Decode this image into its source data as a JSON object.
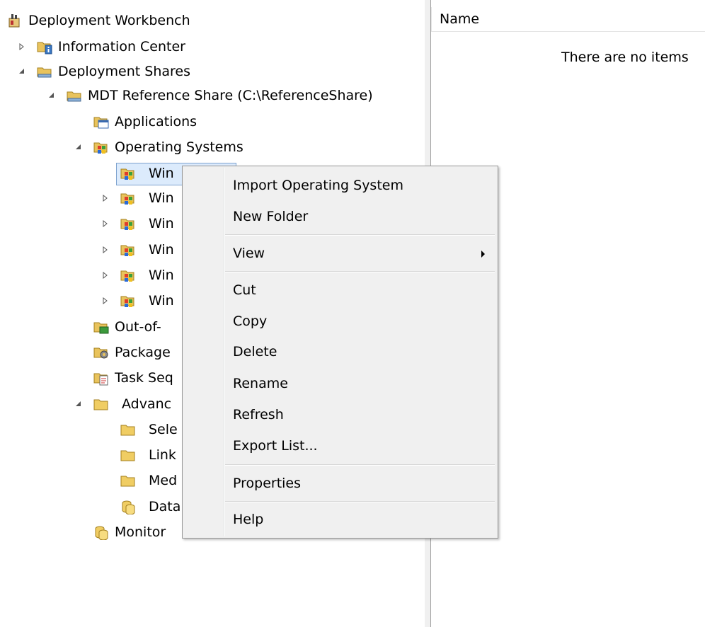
{
  "tree": {
    "root": "Deployment Workbench",
    "information_center": "Information Center",
    "deployment_shares": "Deployment Shares",
    "share": "MDT Reference Share (C:\\ReferenceShare)",
    "applications": "Applications",
    "operating_systems": "Operating Systems",
    "os_children": [
      "Win",
      "Win",
      "Win",
      "Win",
      "Win",
      "Win"
    ],
    "out_of_box": "Out-of-",
    "packages": "Package",
    "task_sequences": "Task Seq",
    "advanced": "Advanc",
    "advanced_children": [
      "Sele",
      "Link",
      "Med",
      "Data"
    ],
    "monitoring": "Monitor"
  },
  "list": {
    "column_name": "Name",
    "empty_message": "There are no items"
  },
  "context_menu": {
    "items": [
      "Import Operating System",
      "New Folder",
      "View",
      "Cut",
      "Copy",
      "Delete",
      "Rename",
      "Refresh",
      "Export List...",
      "Properties",
      "Help"
    ]
  },
  "colors": {
    "selection_fill": "#dcebfc",
    "selection_border": "#7da2ce",
    "menu_bg": "#f0f0f0"
  }
}
